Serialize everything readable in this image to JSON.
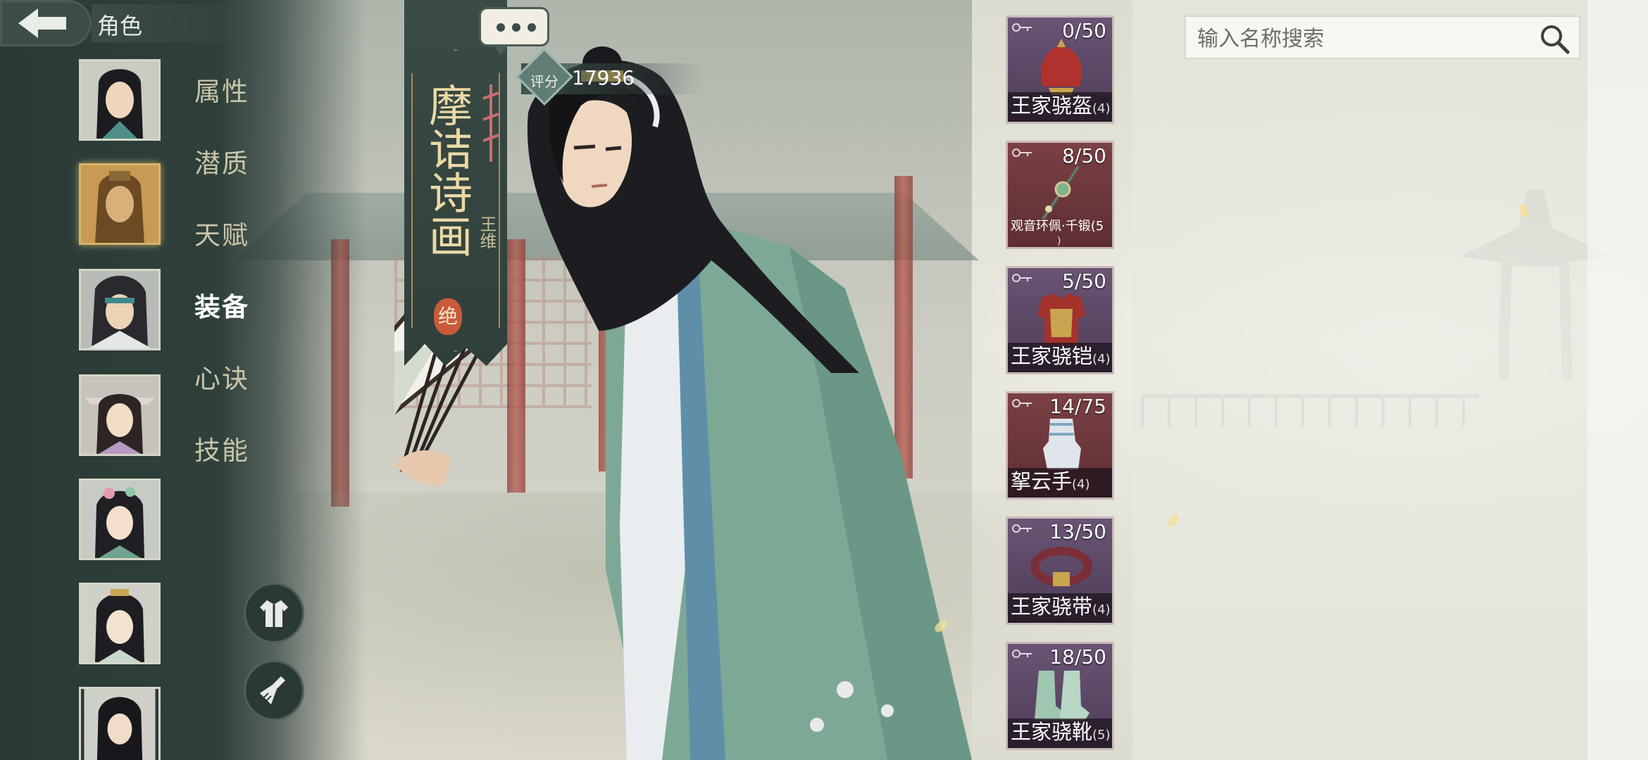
{
  "header": {
    "title": "角色"
  },
  "tabs": [
    {
      "label": "属性",
      "active": false
    },
    {
      "label": "潜质",
      "active": false
    },
    {
      "label": "天赋",
      "active": false
    },
    {
      "label": "装备",
      "active": true
    },
    {
      "label": "心诀",
      "active": false
    },
    {
      "label": "技能",
      "active": false
    }
  ],
  "character": {
    "title": "摩诘诗画",
    "name": "王维",
    "rarity": "绝",
    "score_label": "评分",
    "score": "17936"
  },
  "equipment": [
    {
      "name": "王家骁盔",
      "level": "(4)",
      "count": "0/50",
      "rarity": "purple",
      "icon": "helmet-icon"
    },
    {
      "name": "观音环佩·千锻(5",
      "level": "",
      "wrap": ")",
      "count": "8/50",
      "rarity": "red",
      "icon": "jade-pendant-icon"
    },
    {
      "name": "王家骁铠",
      "level": "(4)",
      "count": "5/50",
      "rarity": "purple",
      "icon": "armor-icon"
    },
    {
      "name": "挐云手",
      "level": "(4)",
      "count": "14/75",
      "rarity": "red",
      "icon": "gauntlet-icon"
    },
    {
      "name": "王家骁带",
      "level": "(4)",
      "count": "13/50",
      "rarity": "purple",
      "icon": "belt-icon"
    },
    {
      "name": "王家骁靴",
      "level": "(5)",
      "count": "18/50",
      "rarity": "purple",
      "icon": "boots-icon"
    }
  ],
  "search": {
    "placeholder": "输入名称搜索",
    "value": ""
  },
  "colors": {
    "panel_dark": "#2f403b",
    "accent_gold": "#d6b36e",
    "rarity_purple": "#5d4867",
    "rarity_red": "#6c373c",
    "seal_red": "#c95a3b"
  }
}
